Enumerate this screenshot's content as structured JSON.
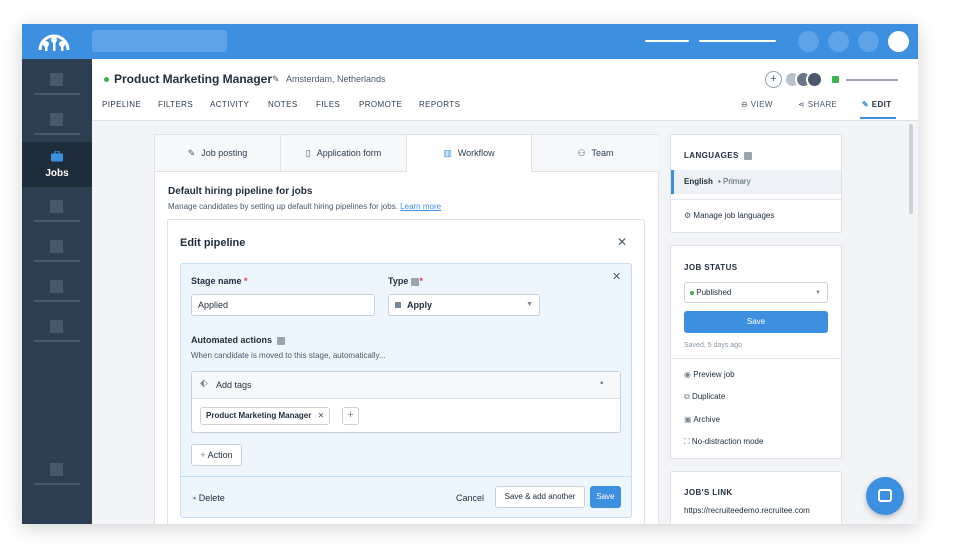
{
  "header": {
    "job_title": "Product Marketing Manager",
    "location": "Amsterdam, Netherlands",
    "tabs": [
      "PIPELINE",
      "FILTERS",
      "ACTIVITY",
      "NOTES",
      "FILES",
      "PROMOTE",
      "REPORTS"
    ],
    "view_label": "VIEW",
    "share_label": "SHARE",
    "edit_label": "EDIT"
  },
  "sidebar": {
    "jobs_label": "Jobs"
  },
  "panel_tabs": [
    "Job posting",
    "Application form",
    "Workflow",
    "Team"
  ],
  "pipeline": {
    "title": "Default hiring pipeline for jobs",
    "description": "Manage candidates by setting up default hiring pipelines for jobs.",
    "learn_more": "Learn more"
  },
  "edit_pipeline": {
    "title": "Edit pipeline",
    "stage_name_label": "Stage name",
    "stage_name_value": "Applied",
    "type_label": "Type",
    "type_value": "Apply",
    "automated_label": "Automated actions",
    "automated_sub": "When candidate is moved to this stage, automatically...",
    "add_tags_label": "Add tags",
    "tag": "Product Marketing Manager",
    "action_label": "Action",
    "delete_label": "Delete",
    "cancel_label": "Cancel",
    "save_add_label": "Save & add another",
    "save_label": "Save"
  },
  "languages": {
    "heading": "LANGUAGES",
    "primary": "English",
    "primary_suffix": "• Primary",
    "manage": "Manage job languages"
  },
  "job_status": {
    "heading": "JOB STATUS",
    "status": "Published",
    "save": "Save",
    "saved": "Saved, 5 days ago",
    "actions": [
      "Preview job",
      "Duplicate",
      "Archive",
      "No-distraction mode"
    ]
  },
  "jobs_link": {
    "heading": "JOB'S LINK",
    "url": "https://recruiteedemo.recruitee.com"
  },
  "colors": {
    "accent": "#3d8fe0",
    "sidebar": "#2d3e50",
    "success": "#3fb24f"
  }
}
